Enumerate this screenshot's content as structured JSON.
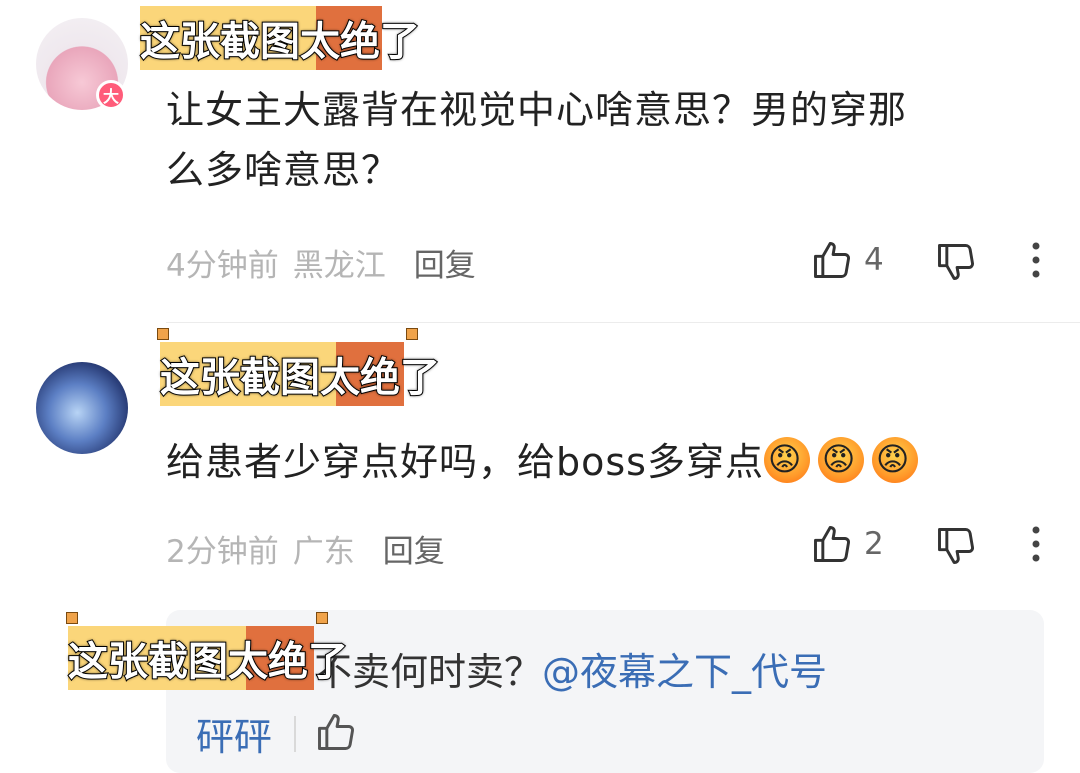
{
  "sticker_text": "这张截图太绝了",
  "comments": [
    {
      "avatar_badge": "大",
      "text_line1": "让女主大露背在视觉中心啥意思？男的穿那",
      "text_line2": "么多啥意思？",
      "time": "4分钟前",
      "location": "黑龙江",
      "reply": "回复",
      "likes": "4"
    },
    {
      "text": "给患者少穿点好吗，给boss多穿点",
      "emoji_count": 3,
      "time": "2分钟前",
      "location": "广东",
      "reply": "回复",
      "likes": "2"
    }
  ],
  "sub_reply": {
    "text": "和男的不卖何时卖？",
    "mention": "@夜幕之下_代号",
    "user": "砰砰"
  },
  "colors": {
    "mention": "#3a6db5",
    "sticker_left": "#fbd67a",
    "sticker_right": "#e0703e"
  }
}
